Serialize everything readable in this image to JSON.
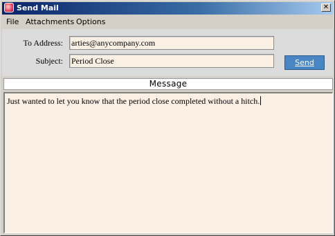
{
  "window": {
    "title": "Send Mail",
    "close_glyph": "✕",
    "icon": "mail-app-icon"
  },
  "menu": {
    "items": [
      {
        "label": "File"
      },
      {
        "label": "Attachments"
      },
      {
        "label": "Options"
      }
    ]
  },
  "form": {
    "to_label": "To Address:",
    "to_value": "arties@anycompany.com",
    "subject_label": "Subject:",
    "subject_value": "Period Close",
    "send_label": "Send"
  },
  "message": {
    "header": "Message",
    "body": "Just wanted to let you know that the period close completed without a hitch."
  },
  "colors": {
    "field_background": "#fbf0e4",
    "send_button": "#4a86c3",
    "titlebar_start": "#0a246a"
  }
}
